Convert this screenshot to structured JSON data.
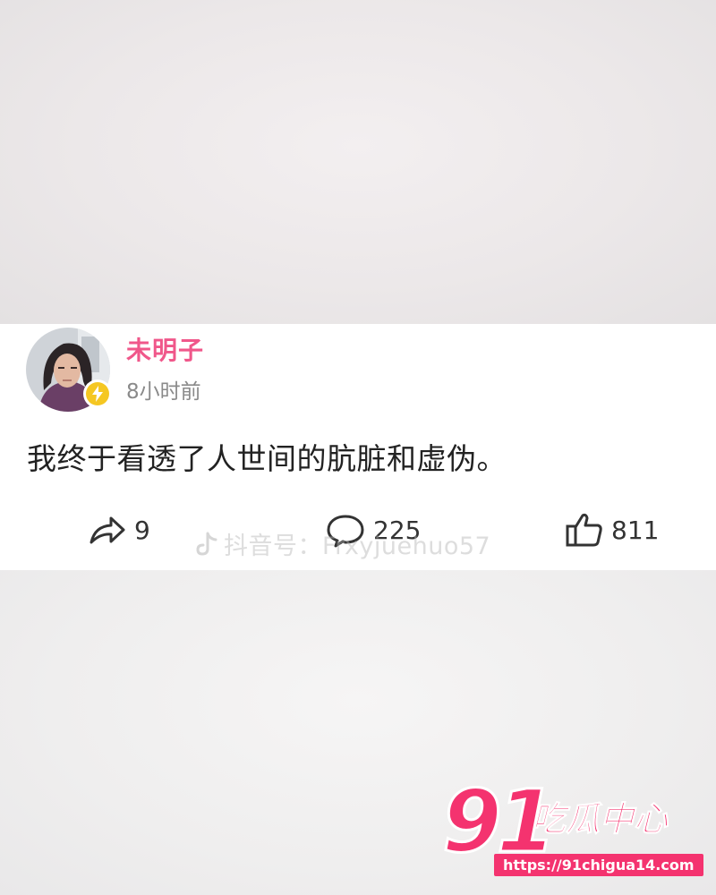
{
  "post": {
    "username": "未明子",
    "time": "8小时前",
    "text": "我终于看透了人世间的肮脏和虚伪。",
    "shares": "9",
    "comments": "225",
    "likes": "811"
  },
  "watermark": {
    "text": "抖音号：Frxyjuehuo57",
    "icon": "douyin-icon"
  },
  "logo": {
    "number": "91",
    "title": "吃瓜中心",
    "url": "https://91chigua14.com"
  },
  "colors": {
    "username": "#f0578a",
    "badge": "#f5c722",
    "logo": "#f4336f"
  }
}
